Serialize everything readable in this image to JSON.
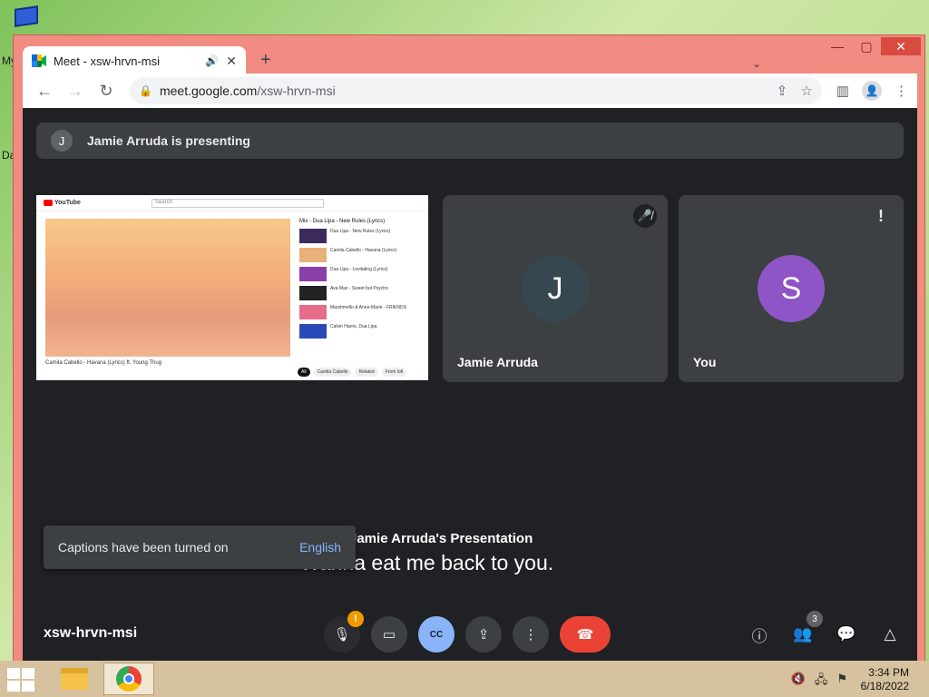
{
  "desktop": {
    "label_1": "My",
    "label_2": "Da"
  },
  "browser": {
    "tab_title": "Meet - xsw-hrvn-msi",
    "new_tab_label": "+",
    "url_domain": "meet.google.com",
    "url_path": "/xsw-hrvn-msi"
  },
  "meet": {
    "presenting_initial": "J",
    "presenting_text": "Jamie Arruda is presenting",
    "participants": [
      {
        "name": "Jamie Arruda",
        "initial": "J",
        "color": "#37474f",
        "status": "mic-off"
      },
      {
        "name": "You",
        "initial": "S",
        "color": "#8e55c6",
        "status": "alert"
      }
    ],
    "screen_share": {
      "site": "YouTube",
      "search_placeholder": "Search",
      "video_title": "Camila Cabello - Havana (Lyrics) ft. Young Thug",
      "video_meta": "Mix - Dua Lipa - New Rules (Lyrics)",
      "playlist": [
        "Dua Lipa - New Rules (Lyrics)",
        "Camila Cabello - Havana (Lyrics)",
        "Dua Lipa - Levitating (Lyrics)",
        "Ava Max - Sweet but Psycho",
        "Marshmello & Anne-Marie - FRIENDS",
        "Calvin Harris, Dua Lipa"
      ],
      "chips": [
        "All",
        "Camila Cabello",
        "Related",
        "From lofi"
      ]
    },
    "caption_speaker": "Jamie Arruda's Presentation",
    "caption_text": "Wanna eat me back to you.",
    "toast_message": "Captions have been turned on",
    "toast_action": "English",
    "meeting_code": "xsw-hrvn-msi",
    "controls": {
      "mic_warning": "!",
      "cc_label": "CC",
      "people_count": "3"
    }
  },
  "taskbar": {
    "time": "3:34 PM",
    "date": "6/18/2022"
  }
}
